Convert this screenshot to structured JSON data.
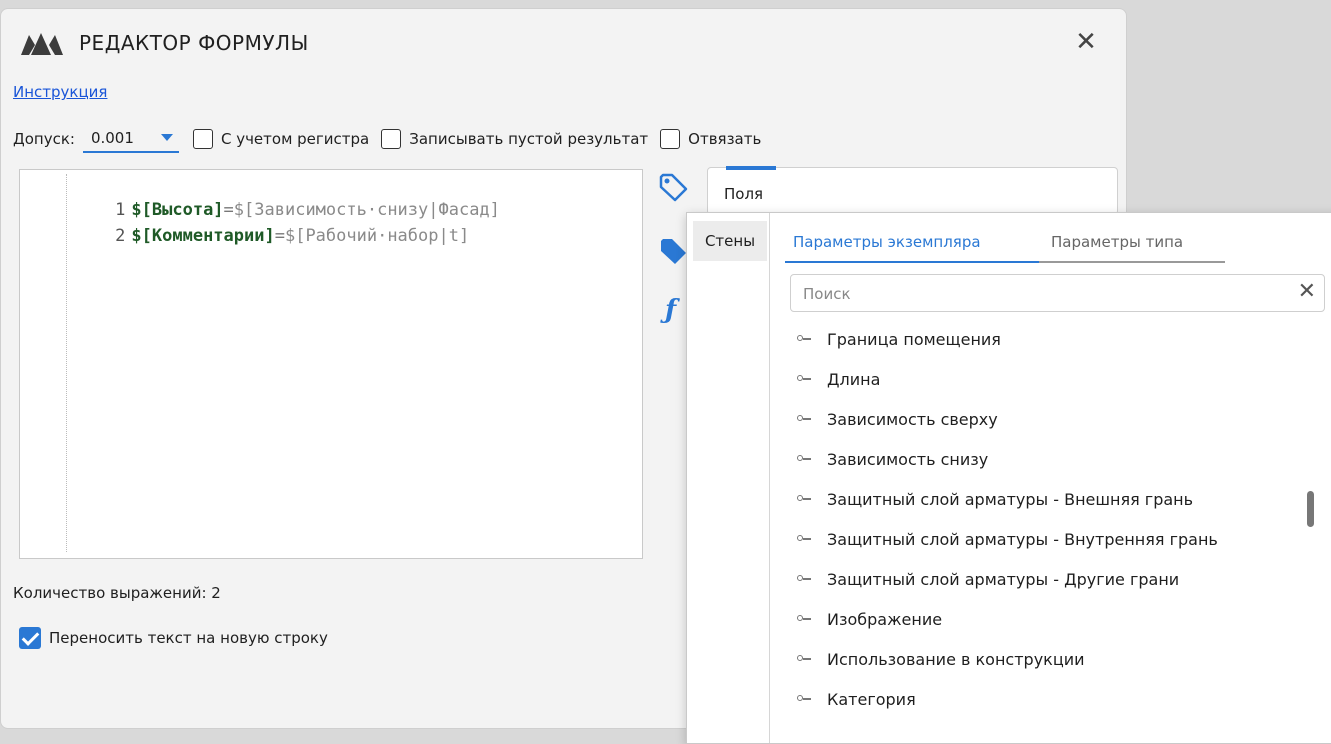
{
  "window": {
    "title": "РЕДАКТОР ФОРМУЛЫ",
    "instruction_link": "Инструкция"
  },
  "toolbar": {
    "tolerance_label": "Допуск:",
    "tolerance_value": "0.001",
    "case_sensitive": "С учетом регистра",
    "write_empty": "Записывать пустой результат",
    "unbind": "Отвязать"
  },
  "editor": {
    "lines": [
      {
        "num": "1",
        "var": "$[Высота]",
        "eq": "=",
        "ref": "$[Зависимость·снизу|Фасад]"
      },
      {
        "num": "2",
        "var": "$[Комментарии]",
        "eq": "=",
        "ref": "$[Рабочий·набор|t]"
      }
    ]
  },
  "status": {
    "expr_count": "Количество выражений: 2",
    "wrap_text": "Переносить текст на новую строку"
  },
  "fields_panel": {
    "label": "Поля"
  },
  "popup": {
    "category": "Стены",
    "tab_instance": "Параметры экземпляра",
    "tab_type": "Параметры типа",
    "search_placeholder": "Поиск",
    "items": [
      "Граница помещения",
      "Длина",
      "Зависимость сверху",
      "Зависимость снизу",
      "Защитный слой арматуры - Внешняя грань",
      "Защитный слой арматуры - Внутренняя грань",
      "Защитный слой арматуры - Другие грани",
      "Изображение",
      "Использование в конструкции",
      "Категория"
    ]
  },
  "colors": {
    "accent": "#2a78d4",
    "var": "#1f5a27"
  }
}
